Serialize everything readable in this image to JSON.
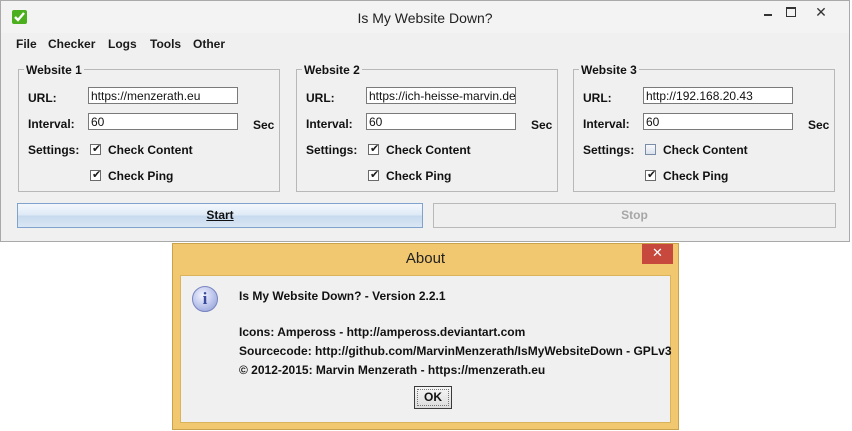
{
  "window": {
    "title": "Is My Website Down?",
    "close_glyph": "✕"
  },
  "menu": [
    "File",
    "Checker",
    "Logs",
    "Tools",
    "Other"
  ],
  "panels": [
    {
      "title": "Website 1",
      "url_label": "URL:",
      "url": "https://menzerath.eu",
      "interval_label": "Interval:",
      "interval": "60",
      "interval_unit": "Sec",
      "settings_label": "Settings:",
      "check_content_label": "Check Content",
      "check_content": true,
      "check_ping_label": "Check Ping",
      "check_ping": true
    },
    {
      "title": "Website 2",
      "url_label": "URL:",
      "url": "https://ich-heisse-marvin.de",
      "interval_label": "Interval:",
      "interval": "60",
      "interval_unit": "Sec",
      "settings_label": "Settings:",
      "check_content_label": "Check Content",
      "check_content": true,
      "check_ping_label": "Check Ping",
      "check_ping": true
    },
    {
      "title": "Website 3",
      "url_label": "URL:",
      "url": "http://192.168.20.43",
      "interval_label": "Interval:",
      "interval": "60",
      "interval_unit": "Sec",
      "settings_label": "Settings:",
      "check_content_label": "Check Content",
      "check_content": false,
      "check_ping_label": "Check Ping",
      "check_ping": true
    }
  ],
  "buttons": {
    "start": "Start",
    "stop": "Stop"
  },
  "about": {
    "title": "About",
    "close_glyph": "✕",
    "info_glyph": "i",
    "lines": [
      "Is My Website Down? - Version 2.2.1",
      "Icons: Ampeross - http://ampeross.deviantart.com",
      "Sourcecode: http://github.com/MarvinMenzerath/IsMyWebsiteDown - GPLv3",
      "© 2012-2015: Marvin Menzerath - https://menzerath.eu"
    ],
    "ok": "OK"
  },
  "colors": {
    "dialog_frame": "#f1c86f",
    "close_red": "#c7493e",
    "app_icon_green": "#4caf1e"
  },
  "icons": {
    "app": "check-icon",
    "info": "info-icon",
    "check": "check-mark-icon"
  }
}
